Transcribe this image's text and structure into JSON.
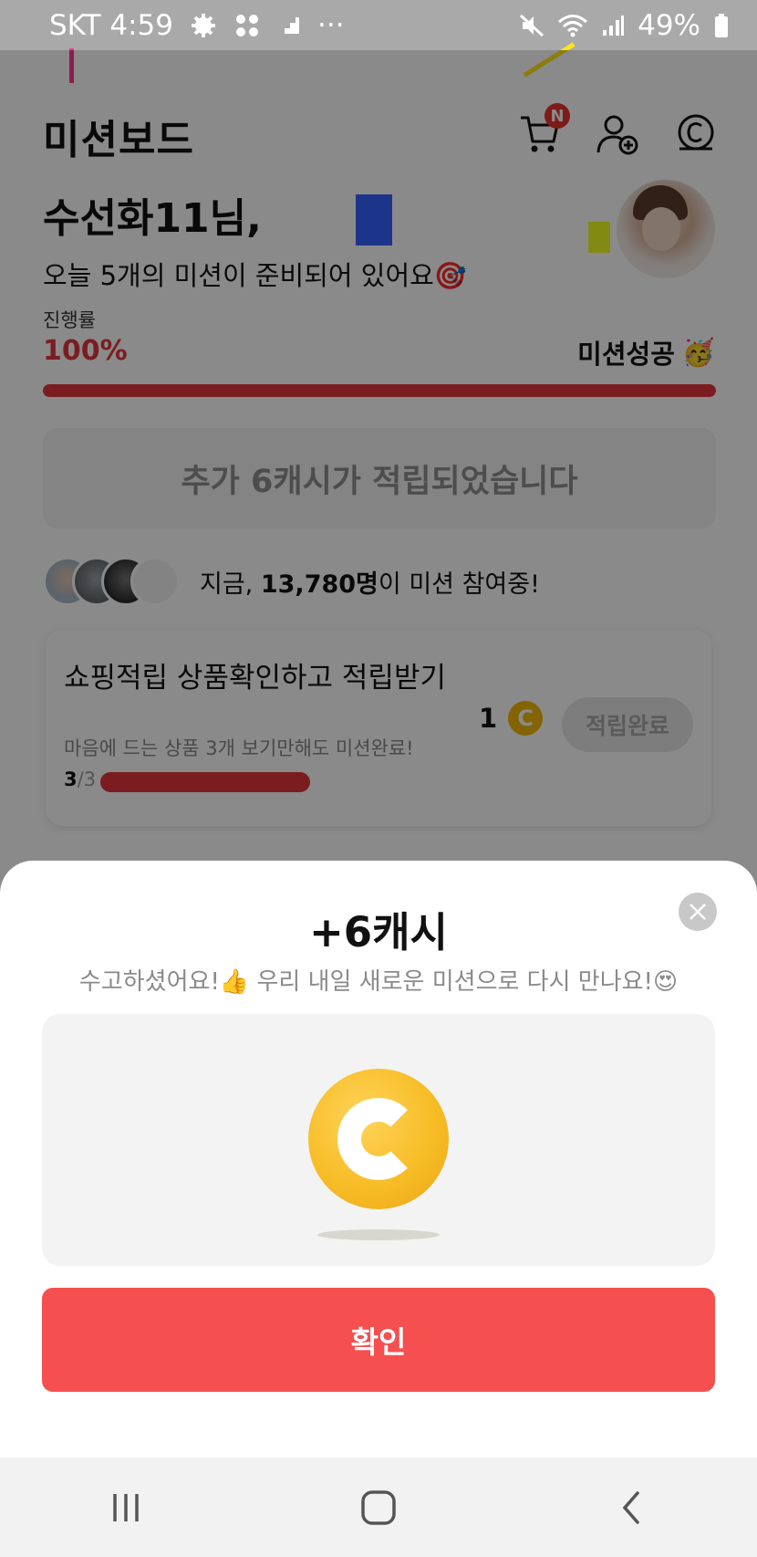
{
  "status_bar": {
    "carrier_time": "SKT 4:59",
    "dots": "···",
    "battery": "49%"
  },
  "header": {
    "title": "미션보드",
    "cart_badge": "N"
  },
  "greeting": {
    "name": "수선화11님,",
    "subtitle": "오늘 5개의 미션이 준비되어 있어요🎯"
  },
  "progress": {
    "label": "진행률",
    "value": "100%",
    "fraction": 1.0,
    "status": "미션성공",
    "status_emoji": "🥳"
  },
  "bonus_banner": "추가 6캐시가 적립되었습니다",
  "participants": {
    "prefix": "지금, ",
    "count": "13,780명",
    "suffix": "이 미션 참여중!"
  },
  "mission_card": {
    "title": "쇼핑적립 상품확인하고 적립받기",
    "description": "마음에 드는 상품 3개 보기만해도 미션완료!",
    "count_done": "3",
    "count_total": "/3",
    "progress_fraction": 1.0,
    "reward": "1",
    "coin_letter": "C",
    "button_label": "적립완료"
  },
  "sheet": {
    "title": "+6캐시",
    "subtitle": "수고하셨어요!👍 우리 내일 새로운 미션으로 다시 만나요!😍",
    "confirm_label": "확인"
  },
  "colors": {
    "accent_red": "#e3363b",
    "confirm_red": "#f54f4f",
    "coin_gold": "#f7bd27"
  },
  "icons": {
    "header": [
      "cart-icon",
      "add-friend-icon",
      "cash-icon"
    ],
    "nav": [
      "recent-apps-icon",
      "home-icon",
      "back-icon"
    ],
    "sheet": [
      "close-icon",
      "cash-coin-icon"
    ]
  }
}
